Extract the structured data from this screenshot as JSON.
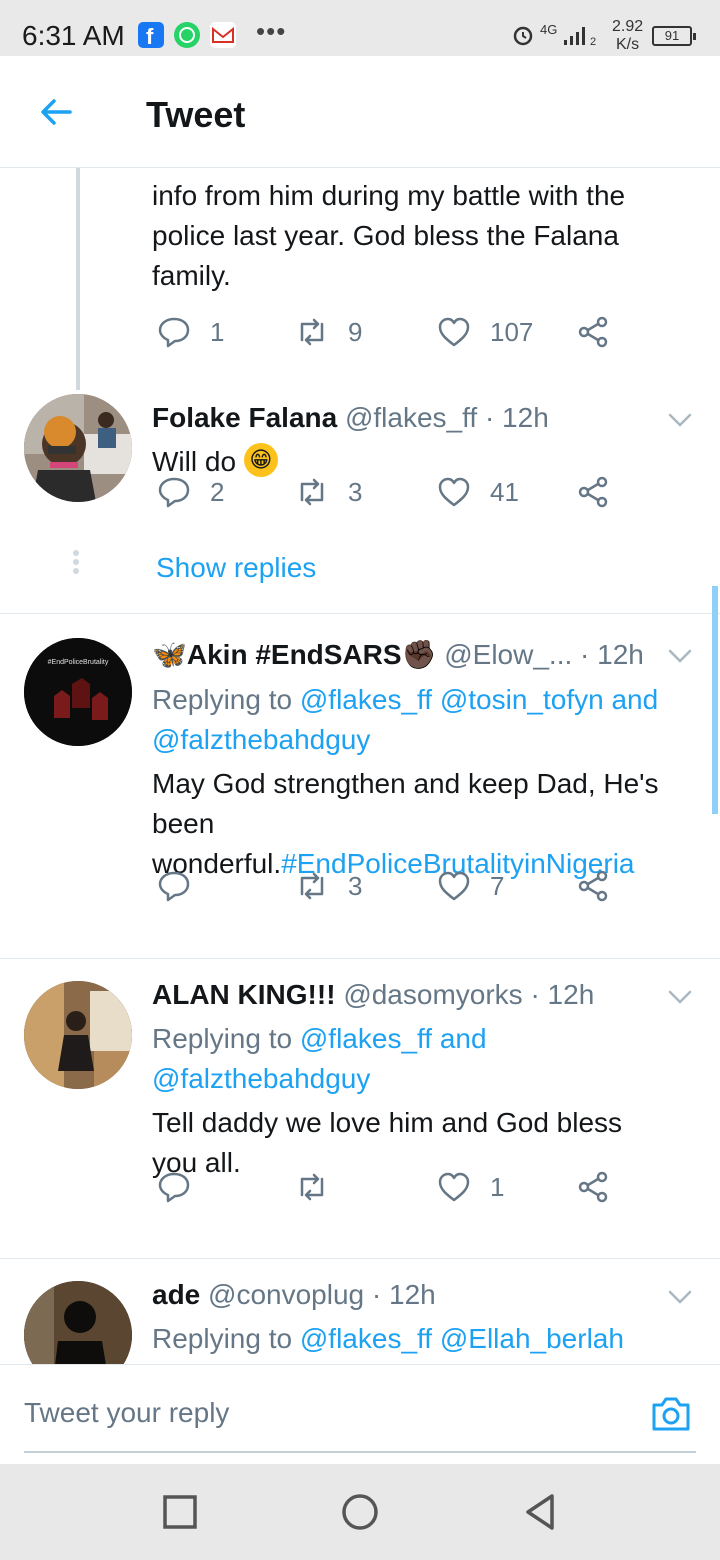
{
  "status_bar": {
    "time": "6:31 AM",
    "network": "4G",
    "speed_value": "2.92",
    "speed_unit": "K/s",
    "battery": "91",
    "sim": "2"
  },
  "header": {
    "title": "Tweet"
  },
  "colors": {
    "accent": "#1da1f2",
    "muted": "#657786",
    "text": "#14171a"
  },
  "tweets": [
    {
      "body_lines": [
        "info from him during my battle with the",
        "police last year. God bless the Falana",
        "family."
      ],
      "actions": {
        "replies": "1",
        "retweets": "9",
        "likes": "107"
      }
    },
    {
      "name": "Folake Falana",
      "handle": "@flakes_ff · 12h",
      "text": "Will do",
      "emoji": "😁",
      "actions": {
        "replies": "2",
        "retweets": "3",
        "likes": "41"
      },
      "show_replies": "Show replies"
    },
    {
      "name_prefix": "🦋",
      "name": "Akin #EndSARS",
      "name_suffix": "✊🏿",
      "handle": "@Elow_... · 12h",
      "replying_label": "Replying to",
      "replying_to": "@flakes_ff @tosin_tofyn and",
      "replying_to_2": "@falzthebahdguy",
      "text_lines": [
        "May God strengthen and keep Dad, He's",
        "been"
      ],
      "text_last": "wonderful.",
      "hashtag": "#EndPoliceBrutalityinNigeria",
      "avatar_caption": "#EndPoliceBrutality",
      "actions": {
        "replies": "",
        "retweets": "3",
        "likes": "7"
      }
    },
    {
      "name": "ALAN KING!!!",
      "handle": "@dasomyorks · 12h",
      "replying_label": "Replying to",
      "replying_to": "@flakes_ff and",
      "replying_to_2": "@falzthebahdguy",
      "text_lines": [
        "Tell daddy we love him and God bless",
        "you all."
      ],
      "actions": {
        "replies": "",
        "retweets": "",
        "likes": "1"
      }
    },
    {
      "name": "ade",
      "handle": "@convoplug · 12h",
      "replying_label": "Replying to",
      "replying_to": "@flakes_ff @Ellah_berlah"
    }
  ],
  "reply_bar": {
    "placeholder": "Tweet your reply"
  }
}
